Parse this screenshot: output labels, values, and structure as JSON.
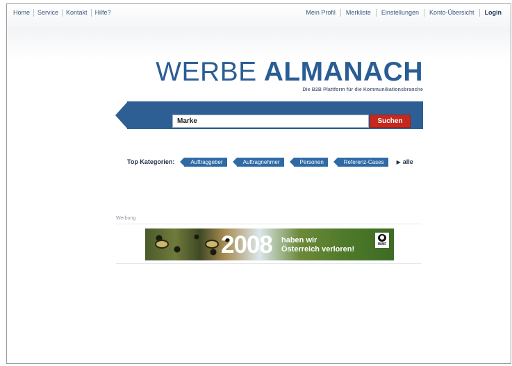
{
  "nav": {
    "left": [
      "Home",
      "Service",
      "Kontakt",
      "Hilfe?"
    ],
    "right": [
      "Mein Profil",
      "Merkliste",
      "Einstellungen",
      "Konto-Übersicht",
      "Login"
    ]
  },
  "logo": {
    "light": "WERBE",
    "bold": "ALMANACH",
    "tagline": "Die B2B Plattform für die Kommunikationsbranche"
  },
  "search": {
    "value": "Marke",
    "button_label": "Suchen"
  },
  "categories": {
    "label": "Top Kategorien:",
    "items": [
      "Auftraggeber",
      "Auftragnehmer",
      "Personen",
      "Referenz-Cases"
    ],
    "all_label": "alle"
  },
  "ad": {
    "label": "Werbung",
    "year": "2008",
    "line1": "haben wir",
    "line2": "Österreich verloren!",
    "brand": "WWF"
  },
  "colors": {
    "brand_blue": "#2d5f95",
    "search_button": "#c5281c"
  }
}
